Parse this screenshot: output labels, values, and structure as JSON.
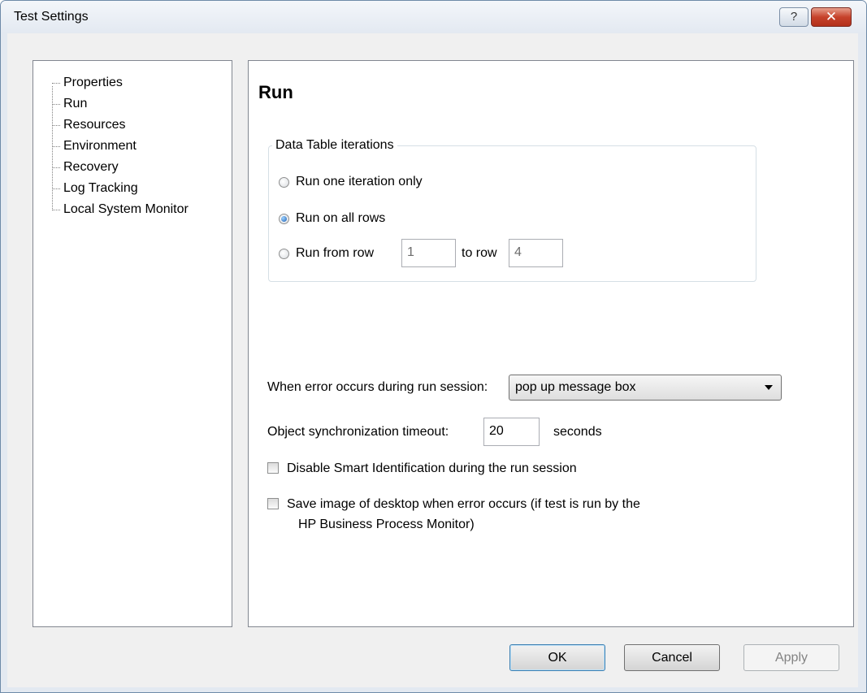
{
  "window": {
    "title": "Test Settings",
    "help_glyph": "?",
    "close_glyph": "✕"
  },
  "tree": {
    "items": [
      {
        "label": "Properties"
      },
      {
        "label": "Run"
      },
      {
        "label": "Resources"
      },
      {
        "label": "Environment"
      },
      {
        "label": "Recovery"
      },
      {
        "label": "Log Tracking"
      },
      {
        "label": "Local System Monitor"
      }
    ],
    "selected": "Run"
  },
  "run_page": {
    "heading": "Run",
    "iterations_group": {
      "label": "Data Table iterations",
      "option_one": "Run one iteration only",
      "option_all": "Run on all rows",
      "option_range": "Run from row",
      "selected": "Run on all rows",
      "from_row": "1",
      "to_row_label": "to row",
      "to_row": "4"
    },
    "error_label": "When error occurs during run session:",
    "error_value": "pop up message box",
    "timeout_label": "Object synchronization timeout:",
    "timeout_value": "20",
    "timeout_unit": "seconds",
    "disable_smart_id_label": "Disable Smart Identification during the run session",
    "disable_smart_id_checked": false,
    "save_image_label_line1": "Save image of desktop when error occurs (if test is run by the",
    "save_image_label_line2": "HP Business Process Monitor)",
    "save_image_checked": false
  },
  "buttons": {
    "ok": "OK",
    "cancel": "Cancel",
    "apply": "Apply"
  },
  "colors": {
    "selection_accent": "#1a5fb4",
    "close_button": "#c6422b"
  }
}
